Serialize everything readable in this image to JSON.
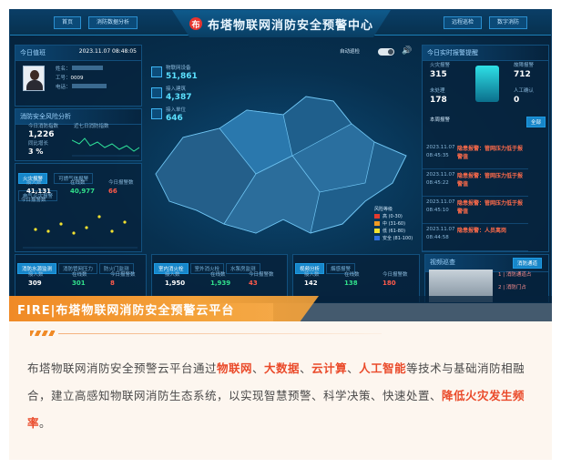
{
  "header": {
    "title": "布塔物联网消防安全预警中心",
    "left_buttons": [
      "首页",
      "消防数据分析"
    ],
    "right_buttons": [
      "远程巡检",
      "数字消防"
    ],
    "switch_label": "自动巡检"
  },
  "duty": {
    "title": "今日值班",
    "datetime": "2023.11.07 08:48:05",
    "name_label": "姓名：",
    "id_label": "工号：",
    "id_value": "0009",
    "phone_label": "电话："
  },
  "stats": [
    {
      "label": "物联网设备",
      "value": "51,861"
    },
    {
      "label": "接入建筑",
      "value": "4,387"
    },
    {
      "label": "接入单位",
      "value": "646"
    }
  ],
  "risk": {
    "title": "消防安全风险分析",
    "index_label": "今日消防指数",
    "index_value": "1,226",
    "ratio_label": "同比增长",
    "ratio_value": "3 %",
    "chart_label": "近七日消防指数"
  },
  "fire_tabs": [
    "火灾报警",
    "可燃气体报警",
    "电气火灾报警"
  ],
  "fire_stats": [
    {
      "label": "接入数",
      "value": "41,131"
    },
    {
      "label": "在线数",
      "value": "40,977"
    },
    {
      "label": "今日报警数",
      "value": "66"
    }
  ],
  "fire_chart_label": "今日报警数",
  "alarm": {
    "title": "今日实时报警提醒",
    "counts": [
      {
        "label": "火灾报警",
        "value": "315"
      },
      {
        "label": "故障报警",
        "value": "712"
      },
      {
        "label": "未处理",
        "value": "178"
      },
      {
        "label": "人工确认",
        "value": "0"
      }
    ],
    "subtitle": "本周报警",
    "all_button": "全部",
    "items": [
      {
        "type": "隐患报警：",
        "text": "管网压力低于报警值",
        "date": "2023.11.07",
        "time": "08:45:35"
      },
      {
        "type": "隐患报警：",
        "text": "管网压力低于报警值",
        "date": "2023.11.07",
        "time": "08:45:22"
      },
      {
        "type": "隐患报警：",
        "text": "管网压力低于报警值",
        "date": "2023.11.07",
        "time": "08:45:10"
      },
      {
        "type": "隐患报警：",
        "text": "人员离岗",
        "date": "2023.11.07",
        "time": "08:44:58"
      },
      {
        "type": "隐患报警：",
        "text": "管网压力低于报警值",
        "date": "2023.11.07",
        "time": "08:44:40"
      }
    ]
  },
  "map_legend": {
    "title": "风险等级",
    "levels": [
      {
        "label": "高 (0-30)",
        "color": "#e53a2e"
      },
      {
        "label": "中 (31-60)",
        "color": "#f19b22"
      },
      {
        "label": "低 (61-80)",
        "color": "#f3e230"
      },
      {
        "label": "安全 (81-100)",
        "color": "#2f6fe0"
      }
    ]
  },
  "bottom": [
    {
      "tabs": [
        "消防水源监测",
        "消防管网压力",
        "防火门监测"
      ],
      "stats": [
        {
          "label": "接入数",
          "value": "309"
        },
        {
          "label": "在线数",
          "value": "301"
        },
        {
          "label": "今日报警数",
          "value": "8"
        }
      ]
    },
    {
      "tabs": [
        "室内消火栓",
        "室外消火栓",
        "水泵房监测"
      ],
      "stats": [
        {
          "label": "接入数",
          "value": "1,950"
        },
        {
          "label": "在线数",
          "value": "1,939"
        },
        {
          "label": "今日报警数",
          "value": "43"
        }
      ]
    },
    {
      "tabs": [
        "视频分析",
        "烟感报警"
      ],
      "stats": [
        {
          "label": "接入数",
          "value": "142"
        },
        {
          "label": "在线数",
          "value": "138"
        },
        {
          "label": "今日报警数",
          "value": "180"
        }
      ]
    }
  ],
  "video": {
    "title": "视频巡查",
    "tab": "消防通道",
    "labels": [
      "1 | 消防通道占",
      "2 | 消防门占"
    ]
  },
  "banner_text": "FIRE|布塔物联网消防安全预警云平台",
  "paragraph": {
    "p1": "布塔物联网消防安全预警云平台通过",
    "k1": "物联网",
    "s1": "、",
    "k2": "大数据",
    "s2": "、",
    "k3": "云计算",
    "s3": "、",
    "k4": "人工智能",
    "p2": "等技术与基础消防相融合，建立高感知物联网消防生态系统，以实现智慧预警、科学决策、快速处置、",
    "k5": "降低火灾发生频率",
    "p3": "。"
  }
}
